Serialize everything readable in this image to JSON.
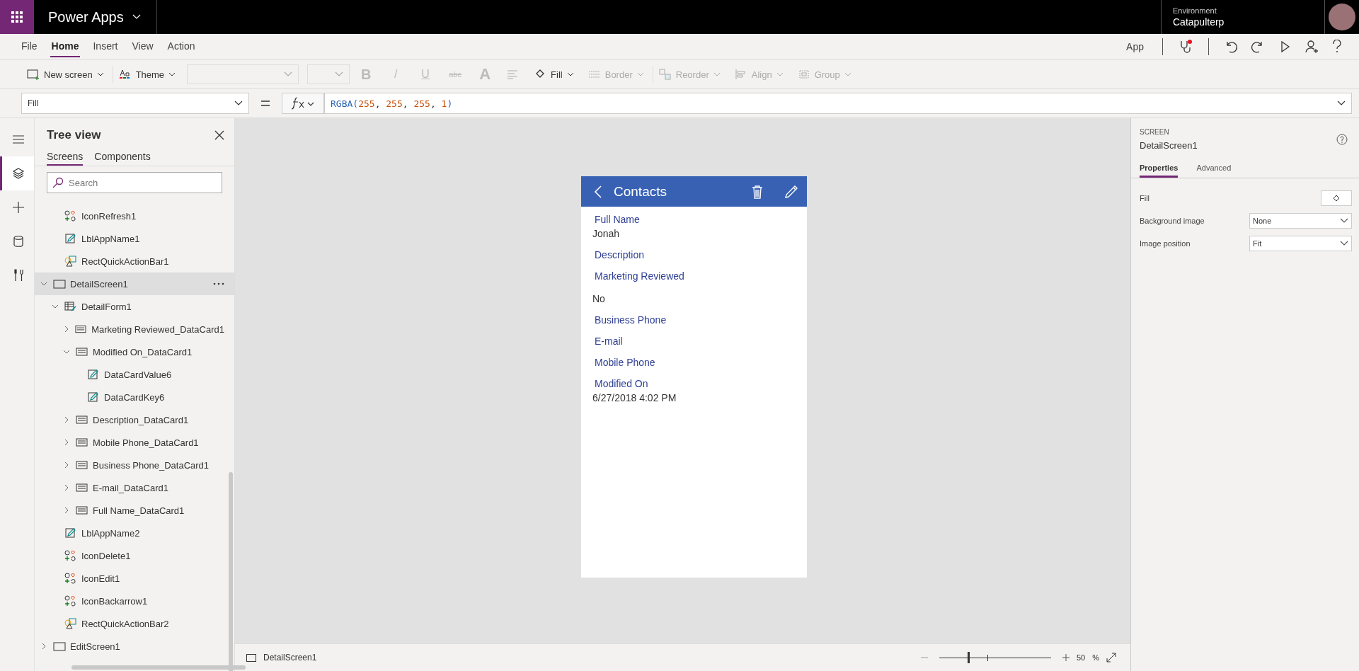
{
  "top_bar": {
    "app_name": "Power Apps",
    "environment_label": "Environment",
    "environment": "Catapulterp"
  },
  "menu": {
    "tabs": [
      {
        "label": "File",
        "selected": false
      },
      {
        "label": "Home",
        "selected": true
      },
      {
        "label": "Insert",
        "selected": false
      },
      {
        "label": "View",
        "selected": false
      },
      {
        "label": "Action",
        "selected": false
      }
    ],
    "app_label": "App",
    "checker_alert": true
  },
  "ribbon": [
    {
      "kind": "new",
      "label": "New screen",
      "disabled": false
    },
    {
      "kind": "theme",
      "label": "Theme",
      "disabled": false
    },
    {
      "kind": "font",
      "disabled": true
    },
    {
      "kind": "size",
      "disabled": true
    },
    {
      "kind": "bold",
      "label": "B",
      "disabled": true
    },
    {
      "kind": "italic",
      "label": "/",
      "disabled": true
    },
    {
      "kind": "underline",
      "label": "U",
      "disabled": true
    },
    {
      "kind": "strike",
      "label": "abc",
      "disabled": true
    },
    {
      "kind": "fontcolor",
      "label": "A",
      "disabled": true
    },
    {
      "kind": "align",
      "disabled": true
    },
    {
      "kind": "fill",
      "label": "Fill",
      "disabled": false
    },
    {
      "kind": "border",
      "label": "Border",
      "disabled": true
    },
    {
      "kind": "reorder",
      "label": "Reorder",
      "disabled": true
    },
    {
      "kind": "alignment",
      "label": "Align",
      "disabled": true
    },
    {
      "kind": "group",
      "label": "Group",
      "disabled": true
    }
  ],
  "formula_bar": {
    "property": "Fill",
    "tokens": [
      {
        "text": "RGBA(",
        "kind": "func"
      },
      {
        "text": "255",
        "kind": "num"
      },
      {
        "text": ", ",
        "kind": "punct"
      },
      {
        "text": "255",
        "kind": "num"
      },
      {
        "text": ", ",
        "kind": "punct"
      },
      {
        "text": "255",
        "kind": "num"
      },
      {
        "text": ", ",
        "kind": "punct"
      },
      {
        "text": "1",
        "kind": "num"
      },
      {
        "text": ")",
        "kind": "func"
      }
    ]
  },
  "rail": [
    {
      "kind": "menu",
      "selected": false
    },
    {
      "kind": "layers",
      "selected": true
    },
    {
      "kind": "insert",
      "selected": false
    },
    {
      "kind": "data",
      "selected": false
    },
    {
      "kind": "tools",
      "selected": false
    }
  ],
  "tree_view": {
    "title": "Tree view",
    "tabs": [
      {
        "label": "Screens",
        "selected": true
      },
      {
        "label": "Components",
        "selected": false
      }
    ],
    "search": {
      "placeholder": "Search"
    },
    "orphan_items": [
      {
        "label": "IconRefresh1",
        "kind": "icon",
        "selected": false
      },
      {
        "label": "LblAppName1",
        "kind": "label",
        "selected": false
      },
      {
        "label": "RectQuickActionBar1",
        "kind": "shape",
        "selected": false
      }
    ],
    "items": [
      {
        "label": "DetailScreen1",
        "kind": "screen",
        "expanded": true,
        "selected": true,
        "children": [
          {
            "label": "DetailForm1",
            "kind": "form",
            "expanded": true,
            "selected": false,
            "children": [
              {
                "label": "Marketing Reviewed_DataCard1",
                "kind": "card",
                "expanded": false,
                "selected": false
              },
              {
                "label": "Modified On_DataCard1",
                "kind": "card",
                "expanded": true,
                "selected": false,
                "children": [
                  {
                    "label": "DataCardValue6",
                    "kind": "label",
                    "selected": false
                  },
                  {
                    "label": "DataCardKey6",
                    "kind": "label",
                    "selected": false
                  }
                ]
              },
              {
                "label": "Description_DataCard1",
                "kind": "card",
                "expanded": false,
                "selected": false
              },
              {
                "label": "Mobile Phone_DataCard1",
                "kind": "card",
                "expanded": false,
                "selected": false
              },
              {
                "label": "Business Phone_DataCard1",
                "kind": "card",
                "expanded": false,
                "selected": false
              },
              {
                "label": "E-mail_DataCard1",
                "kind": "card",
                "expanded": false,
                "selected": false
              },
              {
                "label": "Full Name_DataCard1",
                "kind": "card",
                "expanded": false,
                "selected": false
              }
            ]
          },
          {
            "label": "LblAppName2",
            "kind": "label",
            "selected": false
          },
          {
            "label": "IconDelete1",
            "kind": "icon",
            "selected": false
          },
          {
            "label": "IconEdit1",
            "kind": "icon",
            "selected": false
          },
          {
            "label": "IconBackarrow1",
            "kind": "icon",
            "selected": false
          },
          {
            "label": "RectQuickActionBar2",
            "kind": "shape",
            "selected": false
          }
        ]
      },
      {
        "label": "EditScreen1",
        "kind": "screen",
        "expanded": false,
        "selected": false
      }
    ]
  },
  "canvas": {
    "title": "Contacts",
    "fields": [
      {
        "label": "Full Name",
        "value": "Jonah"
      },
      {
        "label": "Description"
      },
      {
        "label": "Marketing Reviewed",
        "value": "No"
      },
      {
        "label": "Business Phone"
      },
      {
        "label": "E-mail"
      },
      {
        "label": "Mobile Phone"
      },
      {
        "label": "Modified On",
        "value": "6/27/2018 4:02 PM"
      }
    ]
  },
  "status_bar": {
    "screen": "DetailScreen1",
    "zoom": {
      "level": 0.26
    },
    "zoom_value": "50",
    "zoom_unit": "%"
  },
  "properties_panel": {
    "type": "SCREEN",
    "name": "DetailScreen1",
    "tabs": [
      {
        "label": "Properties",
        "selected": true
      },
      {
        "label": "Advanced",
        "selected": false
      }
    ],
    "properties": [
      {
        "label": "Fill",
        "kind": "color"
      },
      {
        "label": "Background image",
        "kind": "dropdown",
        "value": "None"
      },
      {
        "label": "Image position",
        "kind": "dropdown",
        "value": "Fit"
      }
    ]
  }
}
